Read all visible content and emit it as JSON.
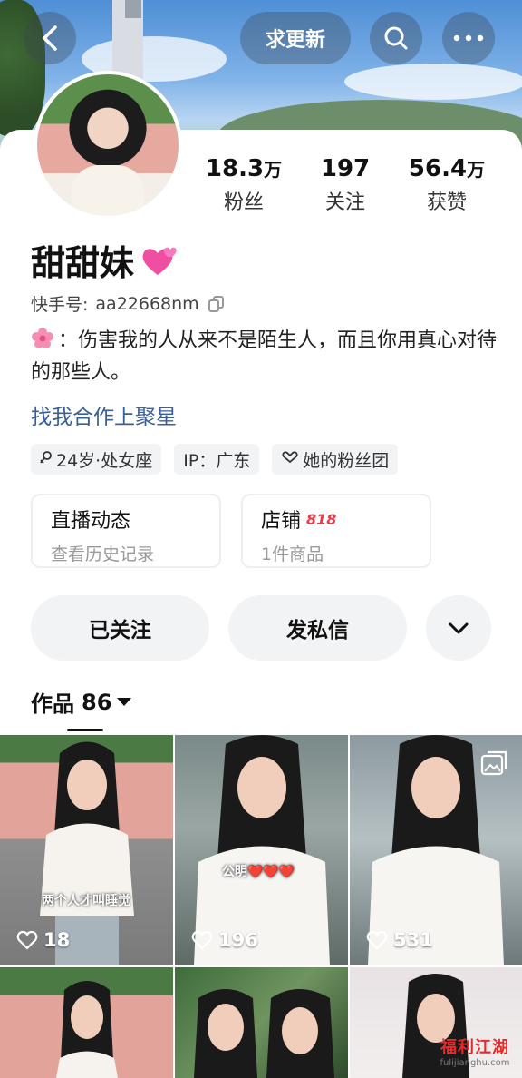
{
  "header": {
    "update_label": "求更新"
  },
  "profile": {
    "name": "甜甜妹",
    "kuaishou_id_label": "快手号:",
    "kuaishou_id": "aa22668nm",
    "bio": "：伤害我的人从来不是陌生人，而且你用真心对待的那些人。",
    "cooperate_link": "找我合作上聚星"
  },
  "stats": [
    {
      "num": "18.3",
      "unit": "万",
      "label": "粉丝"
    },
    {
      "num": "197",
      "unit": "",
      "label": "关注"
    },
    {
      "num": "56.4",
      "unit": "万",
      "label": "获赞"
    }
  ],
  "tags": [
    {
      "icon": "gender-female-icon",
      "text": "24岁·处女座"
    },
    {
      "icon": "",
      "text": "IP：广东"
    },
    {
      "icon": "fan-group-icon",
      "text": "她的粉丝团"
    }
  ],
  "entries": [
    {
      "title": "直播动态",
      "badge": "",
      "subtitle": "查看历史记录"
    },
    {
      "title": "店铺",
      "badge": "818",
      "subtitle": "1件商品"
    }
  ],
  "actions": {
    "followed_label": "已关注",
    "message_label": "发私信"
  },
  "works": {
    "label": "作品",
    "count": "86"
  },
  "tiles": [
    {
      "likes": "18",
      "caption": "两个人才叫睡觉"
    },
    {
      "likes": "196",
      "caption": "公明❤️❤️❤️"
    },
    {
      "likes": "531",
      "caption": ""
    }
  ],
  "watermark": {
    "line1": "福利江湖",
    "line2": "fulijianghu.com"
  },
  "colors": {
    "accent_link": "#3a5f96",
    "badge_red": "#e53b4a",
    "pill_bg": "#f2f3f5"
  }
}
